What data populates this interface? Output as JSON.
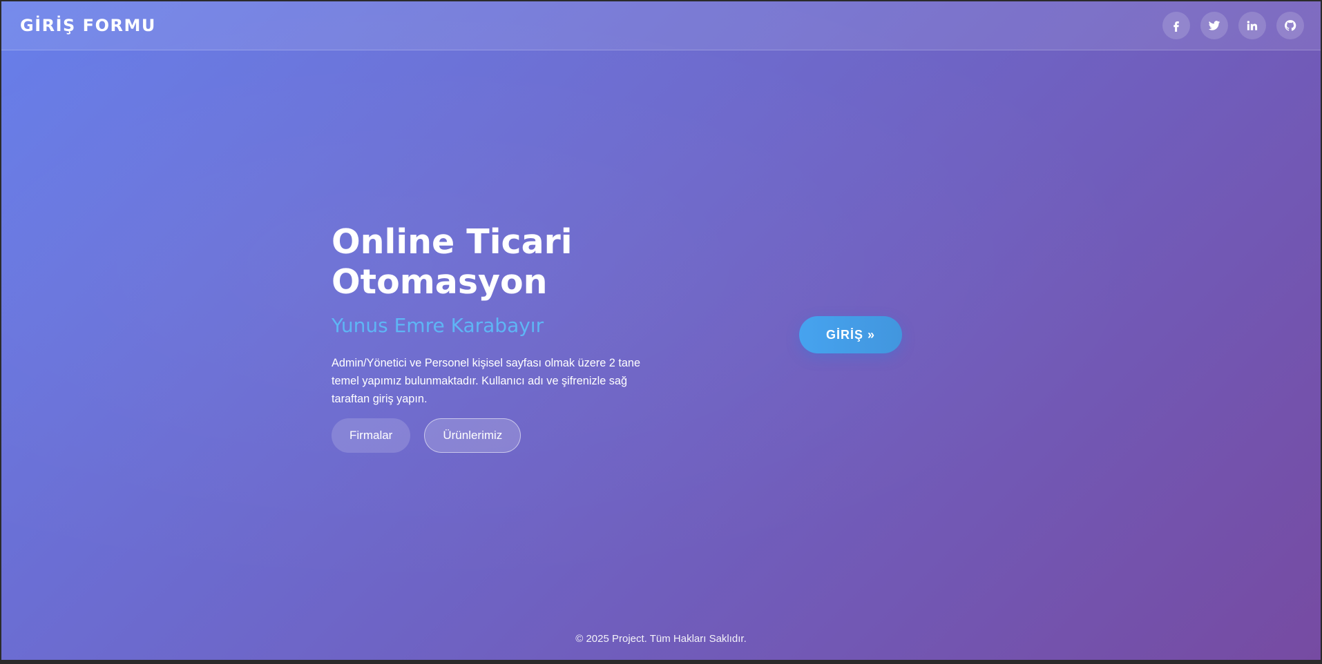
{
  "navbar": {
    "brand": "GİRİŞ FORMU",
    "socials": [
      {
        "icon": "facebook-icon"
      },
      {
        "icon": "twitter-icon"
      },
      {
        "icon": "linkedin-icon"
      },
      {
        "icon": "github-icon"
      }
    ]
  },
  "hero": {
    "title_line1": "Online Ticari",
    "title_line2": "Otomasyon",
    "subtitle": "Yunus Emre Karabayır",
    "description": "Admin/Yönetici ve Personel kişisel sayfası olmak üzere 2 tane temel yapımız bulunmaktadır. Kullanıcı adı ve şifrenizle sağ taraftan giriş yapın.",
    "buttons": {
      "firmalar": "Firmalar",
      "urunlerimiz": "Ürünlerimiz"
    }
  },
  "login": {
    "label": "GİRİŞ »"
  },
  "footer": {
    "text": "© 2025 Project. Tüm Hakları Saklıdır."
  },
  "colors": {
    "gradient_start": "#667eea",
    "gradient_end": "#764ba2",
    "accent": "#5eb6f5",
    "login_button": "#4299e1"
  }
}
